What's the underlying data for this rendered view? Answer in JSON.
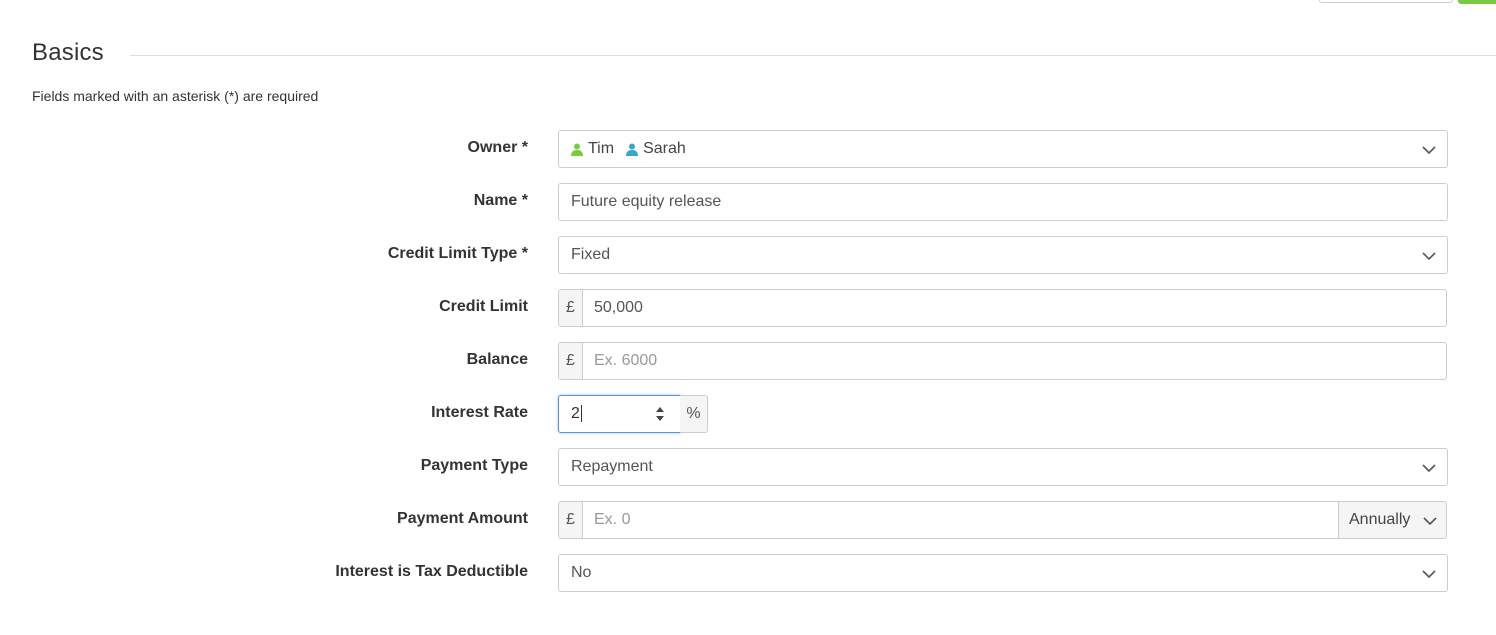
{
  "section": {
    "title": "Basics",
    "required_note": "Fields marked with an asterisk (*) are required"
  },
  "colors": {
    "owner1_icon": "#7ac943",
    "owner2_icon": "#3aa6c7",
    "focus_border": "#5b8fd6",
    "top_button_green": "#7ac943"
  },
  "fields": {
    "owner": {
      "label": "Owner *",
      "owners": [
        {
          "name": "Tim",
          "icon": "user-icon"
        },
        {
          "name": "Sarah",
          "icon": "user-icon"
        }
      ]
    },
    "name": {
      "label": "Name *",
      "value": "Future equity release"
    },
    "credit_limit_type": {
      "label": "Credit Limit Type *",
      "value": "Fixed"
    },
    "credit_limit": {
      "label": "Credit Limit",
      "prefix": "£",
      "value": "50,000"
    },
    "balance": {
      "label": "Balance",
      "prefix": "£",
      "placeholder": "Ex. 6000"
    },
    "interest_rate": {
      "label": "Interest Rate",
      "value": "2",
      "suffix": "%"
    },
    "payment_type": {
      "label": "Payment Type",
      "value": "Repayment"
    },
    "payment_amount": {
      "label": "Payment Amount",
      "prefix": "£",
      "placeholder": "Ex. 0",
      "frequency": "Annually"
    },
    "tax_deductible": {
      "label": "Interest is Tax Deductible",
      "value": "No"
    }
  }
}
